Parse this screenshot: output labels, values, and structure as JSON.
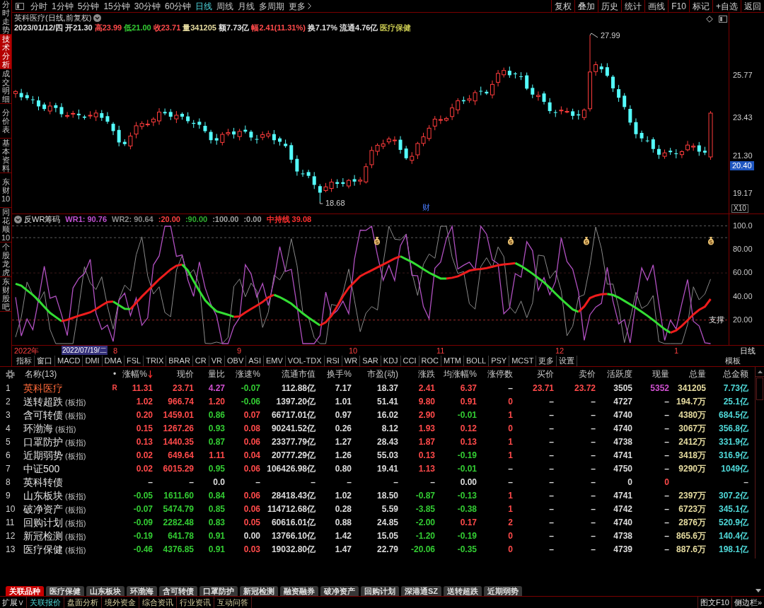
{
  "sidebar": {
    "tabs": [
      {
        "label": "分时走势",
        "selected": false
      },
      {
        "label": "技术分析",
        "selected": true
      },
      {
        "label": "成交明细",
        "selected": false
      },
      {
        "label": "分价表",
        "selected": false
      },
      {
        "label": "基本资料",
        "selected": false
      },
      {
        "label": "东财10",
        "selected": false
      },
      {
        "label": "同花顺10",
        "selected": false
      },
      {
        "label": "个股龙虎",
        "selected": false
      },
      {
        "label": "东财股吧",
        "selected": false
      }
    ]
  },
  "toolbar": {
    "periods": [
      {
        "label": "分时",
        "selected": false
      },
      {
        "label": "1分钟",
        "selected": false
      },
      {
        "label": "5分钟",
        "selected": false
      },
      {
        "label": "15分钟",
        "selected": false
      },
      {
        "label": "30分钟",
        "selected": false
      },
      {
        "label": "60分钟",
        "selected": false
      },
      {
        "label": "日线",
        "selected": true
      },
      {
        "label": "周线",
        "selected": false
      },
      {
        "label": "月线",
        "selected": false
      },
      {
        "label": "多周期",
        "selected": false
      }
    ],
    "more_label": "更多",
    "buttons": [
      "复权",
      "叠加",
      "历史",
      "统计",
      "画线",
      "F10",
      "标记",
      "+自选",
      "返回"
    ]
  },
  "chart": {
    "title": "英科医疗(日线,前复权)",
    "quote": [
      {
        "text": "2023/01/12/四",
        "color": "#e0e0e0"
      },
      {
        "text": "开21.30",
        "color": "#e0e0e0"
      },
      {
        "text": "高23.99",
        "color": "#ff4a4a"
      },
      {
        "text": "低21.00",
        "color": "#33cc33"
      },
      {
        "text": "收23.71",
        "color": "#ff4a4a"
      },
      {
        "text": "量341205",
        "color": "#e6dca0"
      },
      {
        "text": "额7.73亿",
        "color": "#e0e0e0"
      },
      {
        "text": "幅2.41(11.31%)",
        "color": "#ff4a4a"
      },
      {
        "text": "换7.17%",
        "color": "#e0e0e0"
      },
      {
        "text": "流通4.76亿",
        "color": "#e0e0e0"
      },
      {
        "text": "医疗保健",
        "color": "#c8c850"
      }
    ],
    "price_axis": [
      "25.77",
      "23.43",
      "21.30",
      "19.17"
    ],
    "cursor_price": "20.40",
    "scale": "X10",
    "high_label": "27.99",
    "low_label": "18.68",
    "news_marker": "财"
  },
  "indicator": {
    "name": "反WR筹码",
    "readouts": [
      {
        "text": "WR1: 90.76",
        "color": "#c050d0"
      },
      {
        "text": "WR2: 90.64",
        "color": "#8a8a8a"
      },
      {
        "text": ":20.00",
        "color": "#ff4040"
      },
      {
        "text": ":90.00",
        "color": "#30b030"
      },
      {
        "text": ":100.00",
        "color": "#a0a0a0"
      },
      {
        "text": ":0.00",
        "color": "#a0a0a0"
      },
      {
        "text": "中持线 39.08",
        "color": "#ff3030"
      }
    ],
    "axis": [
      "100.0",
      "80.00",
      "60.00",
      "40.00",
      "20.00"
    ],
    "support_label": "支撑"
  },
  "date_axis": {
    "year": "2022年",
    "cursor_date": "2022/07/19/二",
    "months": [
      "8",
      "9",
      "10",
      "11",
      "12",
      "1"
    ],
    "period": "日线"
  },
  "indicator_tabs": {
    "tabs": [
      "指标",
      "窗口",
      "MACD",
      "DMI",
      "DMA",
      "FSL",
      "TRIX",
      "BRAR",
      "CR",
      "VR",
      "OBV",
      "ASI",
      "EMV",
      "VOL-TDX",
      "RSI",
      "WR",
      "SAR",
      "KDJ",
      "CCI",
      "ROC",
      "MTM",
      "BOLL",
      "PSY",
      "MCST",
      "更多",
      "设置"
    ],
    "template": "模板"
  },
  "table": {
    "name_header": "名称(13)",
    "flag_header": "•",
    "columns": [
      {
        "label": "涨幅%",
        "sorted": true
      },
      {
        "label": "现价",
        "sorted": false
      },
      {
        "label": "量比",
        "sorted": false
      },
      {
        "label": "涨速%",
        "sorted": false
      },
      {
        "label": "流通市值",
        "sorted": false
      },
      {
        "label": "换手%",
        "sorted": false
      },
      {
        "label": "市盈(动)",
        "sorted": false
      },
      {
        "label": "涨跌",
        "sorted": false
      },
      {
        "label": "均涨幅%",
        "sorted": false
      },
      {
        "label": "涨停数",
        "sorted": false
      },
      {
        "label": "买价",
        "sorted": false
      },
      {
        "label": "卖价",
        "sorted": false
      },
      {
        "label": "活跃度",
        "sorted": false
      },
      {
        "label": "现量",
        "sorted": false
      },
      {
        "label": "总量",
        "sorted": false
      },
      {
        "label": "总金额",
        "sorted": false
      }
    ],
    "rows": [
      {
        "no": "1",
        "name": "英科医疗",
        "flag": "R",
        "selected": true,
        "cells": [
          {
            "text": "11.31",
            "color": "#ff4a4a"
          },
          {
            "text": "23.71",
            "color": "#ff4a4a"
          },
          {
            "text": "4.27",
            "color": "#d050d0"
          },
          {
            "text": "-0.07",
            "color": "#33cc33"
          },
          "112.88亿",
          "7.17",
          "18.37",
          {
            "text": "2.41",
            "color": "#ff4a4a"
          },
          {
            "text": "6.37",
            "color": "#ff4a4a"
          },
          "–",
          {
            "text": "23.71",
            "color": "#ff4a4a"
          },
          {
            "text": "23.72",
            "color": "#ff4a4a"
          },
          "3505",
          {
            "text": "5352",
            "color": "#d050d0"
          },
          "341205",
          "7.73亿"
        ]
      },
      {
        "no": "2",
        "name": "送转超跌",
        "tag": "(板指)",
        "selected": false,
        "cells": [
          {
            "text": "1.02",
            "color": "#ff4a4a"
          },
          {
            "text": "966.74",
            "color": "#ff4a4a"
          },
          {
            "text": "1.20",
            "color": "#ff4a4a"
          },
          {
            "text": "-0.06",
            "color": "#33cc33"
          },
          "1397.20亿",
          "1.01",
          "51.41",
          {
            "text": "9.80",
            "color": "#ff4a4a"
          },
          {
            "text": "0.91",
            "color": "#ff4a4a"
          },
          {
            "text": "0",
            "color": "#ff4a4a"
          },
          "–",
          "–",
          "4727",
          "–",
          "194.7万",
          "25.1亿"
        ]
      },
      {
        "no": "3",
        "name": "含可转债",
        "tag": "(板指)",
        "selected": false,
        "cells": [
          {
            "text": "0.20",
            "color": "#ff4a4a"
          },
          {
            "text": "1459.01",
            "color": "#ff4a4a"
          },
          {
            "text": "0.86",
            "color": "#33cc33"
          },
          {
            "text": "0.07",
            "color": "#ff4a4a"
          },
          "66717.01亿",
          "0.97",
          "16.02",
          {
            "text": "2.90",
            "color": "#ff4a4a"
          },
          {
            "text": "-0.01",
            "color": "#33cc33"
          },
          {
            "text": "1",
            "color": "#ff4a4a"
          },
          "–",
          "–",
          "4740",
          "–",
          "4380万",
          "684.5亿"
        ]
      },
      {
        "no": "4",
        "name": "环渤海",
        "tag": "(板指)",
        "selected": false,
        "cells": [
          {
            "text": "0.15",
            "color": "#ff4a4a"
          },
          {
            "text": "1267.26",
            "color": "#ff4a4a"
          },
          {
            "text": "0.93",
            "color": "#33cc33"
          },
          {
            "text": "0.08",
            "color": "#ff4a4a"
          },
          "90241.52亿",
          "0.26",
          "8.12",
          {
            "text": "1.93",
            "color": "#ff4a4a"
          },
          {
            "text": "0.12",
            "color": "#ff4a4a"
          },
          {
            "text": "0",
            "color": "#ff4a4a"
          },
          "–",
          "–",
          "4740",
          "–",
          "3067万",
          "356.8亿"
        ]
      },
      {
        "no": "5",
        "name": "口罩防护",
        "tag": "(板指)",
        "selected": false,
        "cells": [
          {
            "text": "0.13",
            "color": "#ff4a4a"
          },
          {
            "text": "1440.35",
            "color": "#ff4a4a"
          },
          {
            "text": "0.87",
            "color": "#33cc33"
          },
          {
            "text": "0.06",
            "color": "#ff4a4a"
          },
          "23377.79亿",
          "1.27",
          "28.43",
          {
            "text": "1.87",
            "color": "#ff4a4a"
          },
          {
            "text": "0.13",
            "color": "#ff4a4a"
          },
          {
            "text": "1",
            "color": "#ff4a4a"
          },
          "–",
          "–",
          "4738",
          "–",
          "2412万",
          "331.9亿"
        ]
      },
      {
        "no": "6",
        "name": "近期弱势",
        "tag": "(板指)",
        "selected": false,
        "cells": [
          {
            "text": "0.02",
            "color": "#ff4a4a"
          },
          {
            "text": "649.64",
            "color": "#ff4a4a"
          },
          {
            "text": "1.11",
            "color": "#ff4a4a"
          },
          {
            "text": "0.04",
            "color": "#ff4a4a"
          },
          "20777.29亿",
          "1.26",
          "55.03",
          {
            "text": "0.13",
            "color": "#ff4a4a"
          },
          {
            "text": "-0.19",
            "color": "#33cc33"
          },
          {
            "text": "1",
            "color": "#ff4a4a"
          },
          "–",
          "–",
          "4741",
          "–",
          "3418万",
          "316.9亿"
        ]
      },
      {
        "no": "7",
        "name": "中证500",
        "selected": false,
        "cells": [
          {
            "text": "0.02",
            "color": "#ff4a4a"
          },
          {
            "text": "6015.29",
            "color": "#ff4a4a"
          },
          {
            "text": "0.95",
            "color": "#33cc33"
          },
          {
            "text": "0.06",
            "color": "#ff4a4a"
          },
          "106426.98亿",
          "0.80",
          "19.41",
          {
            "text": "1.13",
            "color": "#ff4a4a"
          },
          {
            "text": "-0.01",
            "color": "#33cc33"
          },
          "–",
          "–",
          "–",
          "4750",
          "–",
          "9290万",
          "1049亿"
        ]
      },
      {
        "no": "8",
        "name": "英科转债",
        "selected": false,
        "cells": [
          "–",
          "–",
          "0.0",
          "–",
          "–",
          "–",
          "–",
          "–",
          "0.00",
          "–",
          "–",
          "–",
          "0",
          {
            "text": "0",
            "color": "#ff4a4a"
          },
          null,
          {
            "text": "–",
            "color": "#c8c8c8"
          }
        ]
      },
      {
        "no": "9",
        "name": "山东板块",
        "tag": "(板指)",
        "selected": false,
        "cells": [
          {
            "text": "-0.05",
            "color": "#33cc33"
          },
          {
            "text": "1611.60",
            "color": "#33cc33"
          },
          {
            "text": "0.84",
            "color": "#33cc33"
          },
          {
            "text": "0.06",
            "color": "#ff4a4a"
          },
          "28418.43亿",
          "1.02",
          "18.50",
          {
            "text": "-0.87",
            "color": "#33cc33"
          },
          {
            "text": "-0.13",
            "color": "#33cc33"
          },
          {
            "text": "1",
            "color": "#ff4a4a"
          },
          "–",
          "–",
          "4741",
          "–",
          "2397万",
          "307.2亿"
        ]
      },
      {
        "no": "10",
        "name": "破净资产",
        "tag": "(板指)",
        "selected": false,
        "cells": [
          {
            "text": "-0.07",
            "color": "#33cc33"
          },
          {
            "text": "5474.79",
            "color": "#33cc33"
          },
          {
            "text": "0.85",
            "color": "#33cc33"
          },
          {
            "text": "0.06",
            "color": "#ff4a4a"
          },
          "114712.68亿",
          "0.28",
          "5.59",
          {
            "text": "-3.85",
            "color": "#33cc33"
          },
          {
            "text": "-0.38",
            "color": "#33cc33"
          },
          {
            "text": "1",
            "color": "#ff4a4a"
          },
          "–",
          "–",
          "4742",
          "–",
          "6723万",
          "345.1亿"
        ]
      },
      {
        "no": "11",
        "name": "回购计划",
        "tag": "(板指)",
        "selected": false,
        "cells": [
          {
            "text": "-0.09",
            "color": "#33cc33"
          },
          {
            "text": "2282.48",
            "color": "#33cc33"
          },
          {
            "text": "0.83",
            "color": "#33cc33"
          },
          {
            "text": "0.05",
            "color": "#ff4a4a"
          },
          "60616.01亿",
          "0.88",
          "24.85",
          {
            "text": "-2.00",
            "color": "#33cc33"
          },
          {
            "text": "0.17",
            "color": "#ff4a4a"
          },
          {
            "text": "2",
            "color": "#ff4a4a"
          },
          "–",
          "–",
          "4740",
          "–",
          "2876万",
          "520.9亿"
        ]
      },
      {
        "no": "12",
        "name": "新冠检测",
        "tag": "(板指)",
        "selected": false,
        "cells": [
          {
            "text": "-0.19",
            "color": "#33cc33"
          },
          {
            "text": "641.78",
            "color": "#33cc33"
          },
          {
            "text": "0.91",
            "color": "#33cc33"
          },
          "0.00",
          "13766.10亿",
          "1.42",
          "15.05",
          {
            "text": "-1.20",
            "color": "#33cc33"
          },
          {
            "text": "-0.19",
            "color": "#33cc33"
          },
          {
            "text": "0",
            "color": "#ff4a4a"
          },
          "–",
          "–",
          "4738",
          "–",
          "865.6万",
          "140.4亿"
        ]
      },
      {
        "no": "13",
        "name": "医疗保健",
        "tag": "(板指)",
        "selected": false,
        "cells": [
          {
            "text": "-0.46",
            "color": "#33cc33"
          },
          {
            "text": "4376.85",
            "color": "#33cc33"
          },
          {
            "text": "0.91",
            "color": "#33cc33"
          },
          {
            "text": "0.03",
            "color": "#ff4a4a"
          },
          "19032.80亿",
          "1.47",
          "22.79",
          {
            "text": "-20.06",
            "color": "#33cc33"
          },
          {
            "text": "-0.35",
            "color": "#33cc33"
          },
          {
            "text": "0",
            "color": "#ff4a4a"
          },
          "–",
          "–",
          "4739",
          "–",
          "887.6万",
          "198.1亿"
        ]
      }
    ]
  },
  "bottom_tabs": [
    {
      "label": "关联品种",
      "selected": true
    },
    {
      "label": "医疗保健",
      "selected": false
    },
    {
      "label": "山东板块",
      "selected": false
    },
    {
      "label": "环渤海",
      "selected": false
    },
    {
      "label": "含可转债",
      "selected": false
    },
    {
      "label": "口罩防护",
      "selected": false
    },
    {
      "label": "新冠检测",
      "selected": false
    },
    {
      "label": "融资融券",
      "selected": false
    },
    {
      "label": "破净资产",
      "selected": false
    },
    {
      "label": "回购计划",
      "selected": false
    },
    {
      "label": "深港通SZ",
      "selected": false
    },
    {
      "label": "送转超跌",
      "selected": false
    },
    {
      "label": "近期弱势",
      "selected": false
    }
  ],
  "status_bar": {
    "expand": "扩展∨",
    "tabs": [
      {
        "label": "关联报价",
        "selected": true
      },
      {
        "label": "盘面分析",
        "selected": false
      },
      {
        "label": "境外资金",
        "selected": false
      },
      {
        "label": "综合资讯",
        "selected": false
      },
      {
        "label": "行业资讯",
        "selected": false
      },
      {
        "label": "互动问答",
        "selected": false
      }
    ],
    "right": [
      "图文F10",
      "侧边栏»"
    ]
  }
}
